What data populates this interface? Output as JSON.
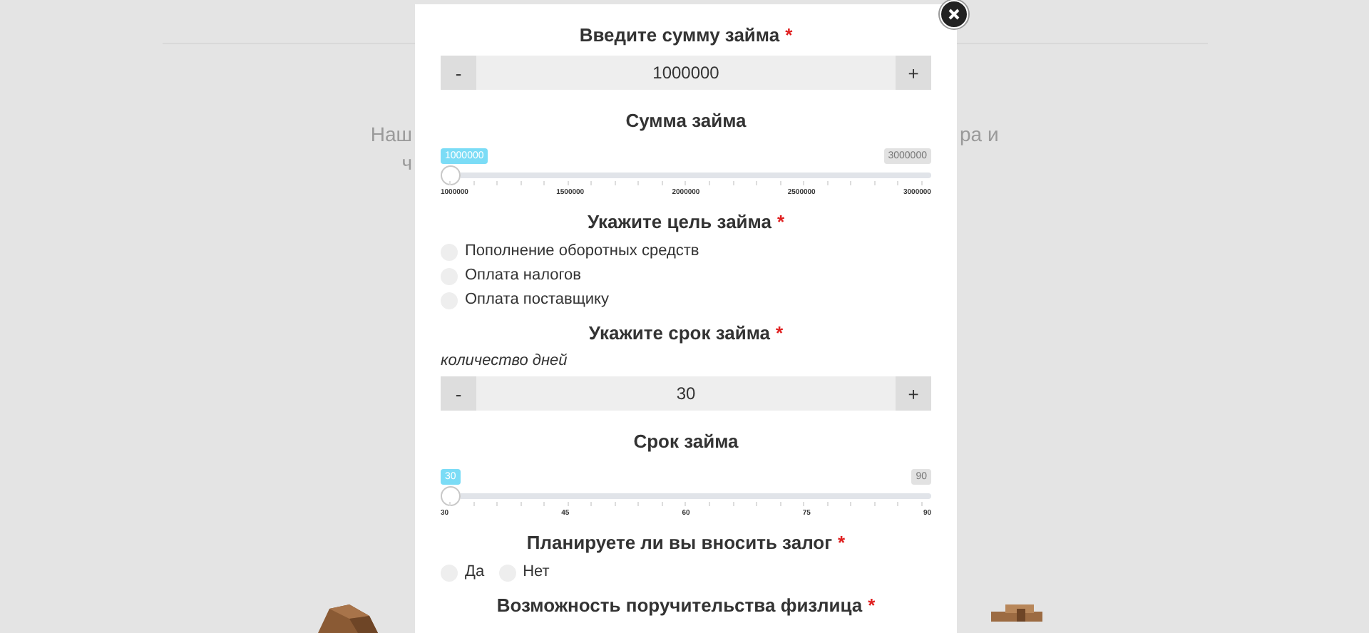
{
  "background": {
    "lines": [
      {
        "left": "Наш",
        "right": "ра и"
      },
      {
        "left": "ч"
      }
    ]
  },
  "modal": {
    "sections": [
      {
        "kind": "stepper",
        "title": "Введите сумму займа",
        "mark": "*",
        "minus": "-",
        "value": "1000000",
        "plus": "+"
      },
      {
        "kind": "slider",
        "title": "Сумма займа",
        "value_label": "1000000",
        "max_label": "3000000",
        "level": 0,
        "ticks": [
          "1000000",
          "1500000",
          "2000000",
          "2500000",
          "3000000"
        ]
      },
      {
        "kind": "radio_list",
        "title": "Укажите цель займа",
        "mark": "*",
        "options": [
          {
            "label": "Пополнение оборотных средств",
            "selected": false
          },
          {
            "label": "Оплата налогов",
            "selected": false
          },
          {
            "label": "Оплата поставщику",
            "selected": false
          }
        ]
      },
      {
        "kind": "stepper",
        "title": "Укажите срок займа",
        "mark": "*",
        "hint": "количество дней",
        "minus": "-",
        "value": "30",
        "plus": "+"
      },
      {
        "kind": "slider",
        "title": "Срок займа",
        "value_label": "30",
        "max_label": "90",
        "level": 0,
        "ticks": [
          "30",
          "45",
          "60",
          "75",
          "90"
        ]
      },
      {
        "kind": "radio_row",
        "title": "Планируете ли вы вносить залог",
        "mark": "*",
        "options": [
          {
            "label": "Да",
            "selected": false
          },
          {
            "label": "Нет",
            "selected": false
          }
        ]
      },
      {
        "kind": "heading",
        "title": "Возможность поручительства физлица",
        "mark": "*"
      }
    ]
  }
}
